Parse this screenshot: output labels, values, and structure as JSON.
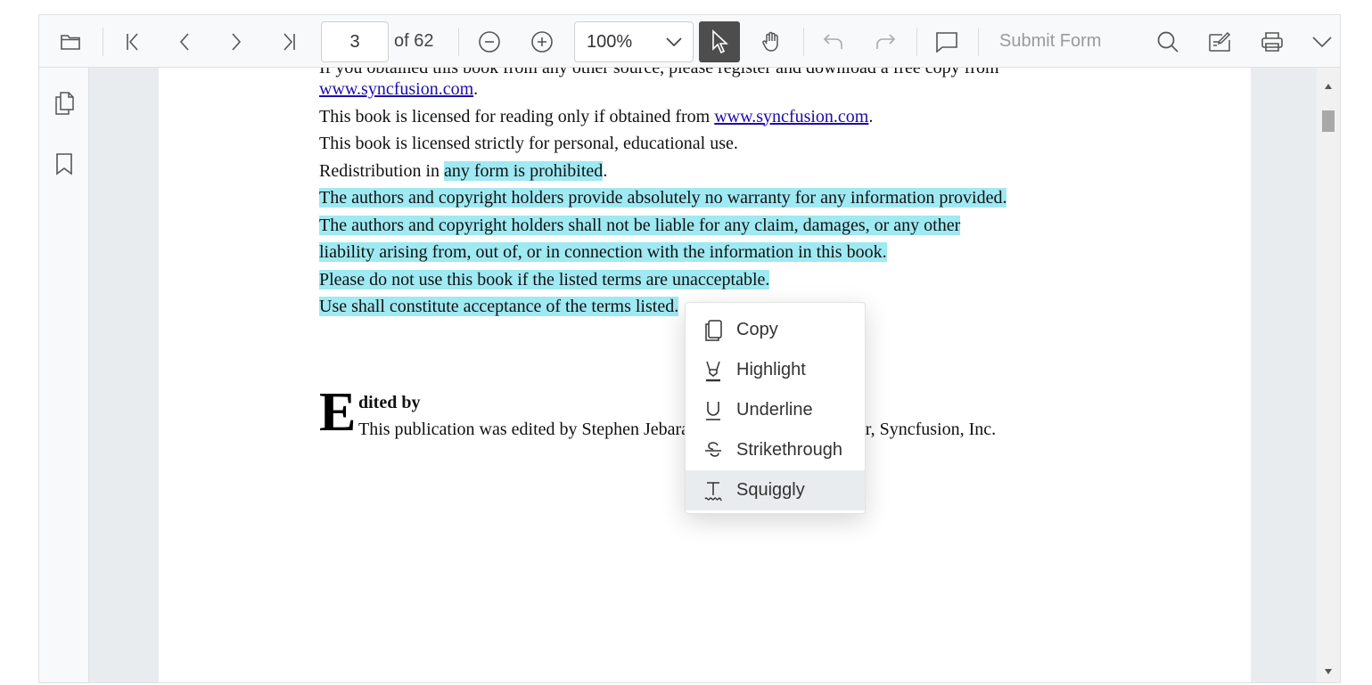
{
  "toolbar": {
    "current_page": "3",
    "page_total": "of 62",
    "zoom": "100%",
    "submit_form": "Submit Form",
    "icons": [
      "folder-open-icon",
      "first-page-icon",
      "previous-page-icon",
      "next-page-icon",
      "last-page-icon",
      "zoom-out-icon",
      "zoom-in-icon",
      "chevron-down-icon",
      "select-cursor-icon",
      "pan-hand-icon",
      "undo-icon",
      "redo-icon",
      "comment-icon",
      "search-icon",
      "annotation-edit-icon",
      "print-icon",
      "more-options-chevron-icon"
    ]
  },
  "sidebar": {
    "icons": [
      "page-thumbnails-icon",
      "bookmark-icon"
    ]
  },
  "document": {
    "cut_top_line": "If you obtained this book from any other source, please register and download a free copy from",
    "lines": [
      {
        "segments": [
          {
            "text": "www.syncfusion.com",
            "style": "link"
          },
          {
            "text": ".",
            "style": "plain"
          }
        ]
      },
      {
        "segments": [
          {
            "text": "This book is licensed for reading only if obtained from ",
            "style": "plain"
          },
          {
            "text": "www.syncfusion.com",
            "style": "link"
          },
          {
            "text": ".",
            "style": "plain"
          }
        ]
      },
      {
        "segments": [
          {
            "text": "This book is licensed strictly for personal, educational use.",
            "style": "plain"
          }
        ]
      },
      {
        "segments": [
          {
            "text": "Redistribution in ",
            "style": "plain"
          },
          {
            "text": "any form is prohibited",
            "style": "hl"
          },
          {
            "text": ".",
            "style": "plain"
          }
        ]
      },
      {
        "segments": [
          {
            "text": "The authors and copyright holders provide absolutely no warranty for any information provided.",
            "style": "hl"
          }
        ]
      },
      {
        "segments": [
          {
            "text": "The authors and copyright holders shall not be liable for any claim, damages, or any other ",
            "style": "hl"
          }
        ]
      },
      {
        "segments": [
          {
            "text": "liability arising from, out of, or in connection with the information in this book.",
            "style": "hl"
          }
        ]
      },
      {
        "segments": [
          {
            "text": "Please do not use this book if the listed terms are unacceptable.",
            "style": "hl"
          }
        ]
      },
      {
        "segments": [
          {
            "text": "Use shall constitute acceptance of the terms listed.",
            "style": "hl"
          }
        ]
      }
    ],
    "drop_cap": "E",
    "edited_heading": "dited by",
    "edited_line": "This publication was edited by Stephen Jebaraj, senior product manager, Syncfusion, Inc.",
    "highlight_color": "#9fe9f2"
  },
  "context_menu": {
    "items": [
      {
        "label": "Copy",
        "icon": "copy-icon"
      },
      {
        "label": "Highlight",
        "icon": "highlight-icon"
      },
      {
        "label": "Underline",
        "icon": "underline-icon"
      },
      {
        "label": "Strikethrough",
        "icon": "strikethrough-icon"
      },
      {
        "label": "Squiggly",
        "icon": "squiggly-icon",
        "active": true
      }
    ]
  },
  "colors": {
    "toolbar_bg": "#f8f9fa",
    "active_tool_bg": "#4d4d4d",
    "page_bg": "#ffffff",
    "canvas_bg": "#e9ecef"
  }
}
